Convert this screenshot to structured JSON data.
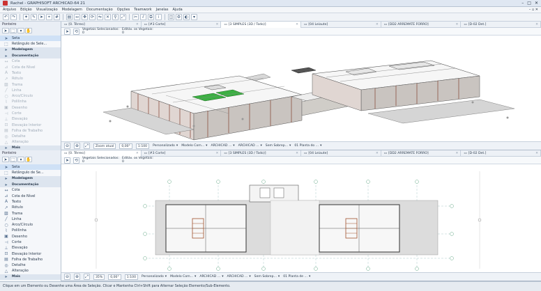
{
  "window": {
    "title": "Rachel - GRAPHISOFT ARCHICAD-64 21"
  },
  "menu": {
    "items": [
      "Arquivo",
      "Edição",
      "Visualização",
      "Modelagem",
      "Documentação",
      "Opções",
      "Teamwork",
      "Janelas",
      "Ajuda"
    ]
  },
  "pane_top": {
    "pointer_label": "Ponteiro",
    "tabs": [
      {
        "label": "[0. Térreo]",
        "active": false
      },
      {
        "label": "[#3 Corte]",
        "active": false
      },
      {
        "label": "[3 SIMPLES (3D / Todo)]",
        "active": true
      },
      {
        "label": "[04 Leiaute]",
        "active": false
      },
      {
        "label": "[DD2 ARREMATE FORRO]",
        "active": false
      },
      {
        "label": "[D-02 Det.]",
        "active": false
      }
    ],
    "info": {
      "selected_label": "Vegetais Selecionados:",
      "selected_value": "0",
      "edit_label": "Editáv. os Vegetais:",
      "edit_value": "0"
    },
    "toolbox": [
      {
        "label": "Seta",
        "icon": "arrow",
        "kind": "sel"
      },
      {
        "label": "Retângulo de Sele...",
        "icon": "rect",
        "kind": "normal"
      },
      {
        "label": "Modelagem",
        "icon": "",
        "kind": "group"
      },
      {
        "label": "Documentação",
        "icon": "",
        "kind": "group"
      },
      {
        "label": "Cota",
        "icon": "dim",
        "kind": "dim"
      },
      {
        "label": "Cota de Nível",
        "icon": "level",
        "kind": "dim"
      },
      {
        "label": "Texto",
        "icon": "A",
        "kind": "dim"
      },
      {
        "label": "Rótulo",
        "icon": "label",
        "kind": "dim"
      },
      {
        "label": "Trama",
        "icon": "fill",
        "kind": "dim"
      },
      {
        "label": "Linha",
        "icon": "line",
        "kind": "dim"
      },
      {
        "label": "Arco/Círculo",
        "icon": "circle",
        "kind": "dim"
      },
      {
        "label": "Polilinha",
        "icon": "poly",
        "kind": "dim"
      },
      {
        "label": "Desenho",
        "icon": "draw",
        "kind": "dim"
      },
      {
        "label": "Corte",
        "icon": "section",
        "kind": "dim"
      },
      {
        "label": "Elevação",
        "icon": "elev",
        "kind": "dim"
      },
      {
        "label": "Elevação Interior",
        "icon": "ielev",
        "kind": "dim"
      },
      {
        "label": "Folha de Trabalho",
        "icon": "sheet",
        "kind": "dim"
      },
      {
        "label": "Detalhe",
        "icon": "detail",
        "kind": "dim"
      },
      {
        "label": "Alteração",
        "icon": "change",
        "kind": "dim"
      },
      {
        "label": "Mais",
        "icon": "",
        "kind": "group"
      }
    ],
    "status": {
      "zoom": "Zoom atual",
      "angle": "0,00°",
      "scale": "1:100",
      "layers": "Personalizado",
      "model": "Modelo Com...",
      "arch1": "ARCHICAD ...",
      "arch2": "ARCHICAD ...",
      "overlay": "Sem Sobrep...",
      "plan": "01 Planta do ..."
    }
  },
  "pane_bottom": {
    "pointer_label": "Ponteiro",
    "tabs": [
      {
        "label": "[0. Térreo]",
        "active": true
      },
      {
        "label": "[#3 Corte]",
        "active": false
      },
      {
        "label": "[3 SIMPLES (3D / Todo)]",
        "active": false
      },
      {
        "label": "[04 Leiaute]",
        "active": false
      },
      {
        "label": "[DD2 ARREMATE FORRO]",
        "active": false
      },
      {
        "label": "[D-02 Det.]",
        "active": false
      }
    ],
    "info": {
      "selected_label": "Vegetais Selecionados:",
      "selected_value": "0",
      "edit_label": "Editáv. os Vegetais:",
      "edit_value": "0"
    },
    "toolbox": [
      {
        "label": "Seta",
        "icon": "arrow",
        "kind": "sel"
      },
      {
        "label": "Retângulo de Se...",
        "icon": "rect",
        "kind": "normal"
      },
      {
        "label": "Modelagem",
        "icon": "",
        "kind": "group"
      },
      {
        "label": "Documentação",
        "icon": "",
        "kind": "group"
      },
      {
        "label": "Cota",
        "icon": "dim",
        "kind": "normal"
      },
      {
        "label": "Cota de Nível",
        "icon": "level",
        "kind": "normal"
      },
      {
        "label": "Texto",
        "icon": "A",
        "kind": "normal"
      },
      {
        "label": "Rótulo",
        "icon": "label",
        "kind": "normal"
      },
      {
        "label": "Trama",
        "icon": "fill",
        "kind": "normal"
      },
      {
        "label": "Linha",
        "icon": "line",
        "kind": "normal"
      },
      {
        "label": "Arco/Círculo",
        "icon": "circle",
        "kind": "normal"
      },
      {
        "label": "Polilinha",
        "icon": "poly",
        "kind": "normal"
      },
      {
        "label": "Desenho",
        "icon": "draw",
        "kind": "normal"
      },
      {
        "label": "Corte",
        "icon": "section",
        "kind": "normal"
      },
      {
        "label": "Elevação",
        "icon": "elev",
        "kind": "normal"
      },
      {
        "label": "Elevação Interior",
        "icon": "ielev",
        "kind": "normal"
      },
      {
        "label": "Folha de Trabalho",
        "icon": "sheet",
        "kind": "normal"
      },
      {
        "label": "Detalhe",
        "icon": "detail",
        "kind": "normal"
      },
      {
        "label": "Alteração",
        "icon": "change",
        "kind": "normal"
      },
      {
        "label": "Mais",
        "icon": "",
        "kind": "group"
      }
    ],
    "status": {
      "zoom": "35%",
      "angle": "0,00°",
      "scale": "1:100",
      "layers": "Personalizado",
      "model": "Modelo Com...",
      "arch1": "ARCHICAD ...",
      "arch2": "ARCHICAD ...",
      "overlay": "Sem Sobrep...",
      "plan": "01 Planta de ..."
    }
  },
  "status_bar": {
    "message": "Clique em um Elemento ou Desenhe uma Área de Seleção. Clicar e Mantenha Ctrl+Shift para Alternar Seleção Elemento/Sub-Elemento."
  },
  "colors": {
    "accent": "#2f6db5",
    "roof": "#f4f4f4",
    "green_roof": "#3cb043",
    "slab": "#dcdcdc",
    "brick": "#b06a5a"
  }
}
